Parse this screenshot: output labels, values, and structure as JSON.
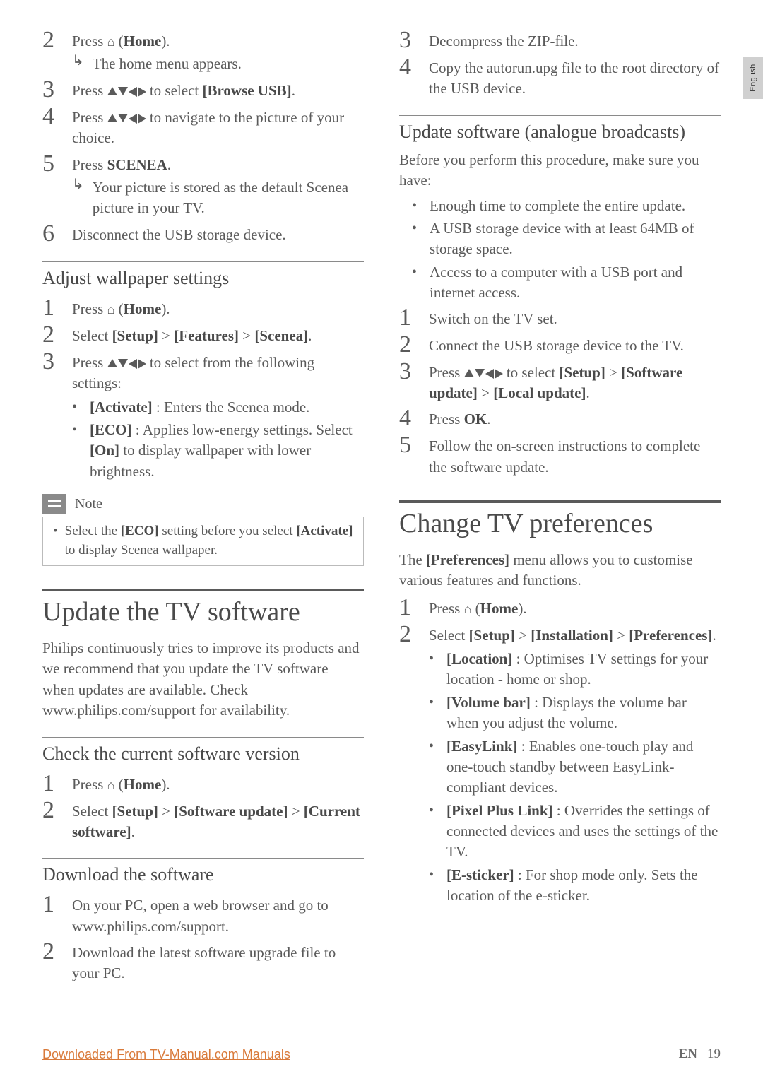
{
  "sideTab": "English",
  "left": {
    "steps1": [
      {
        "n": "2",
        "text": "Press ⌂ (Home).",
        "sub": "The home menu appears."
      },
      {
        "n": "3",
        "text": "Press ▲▼◀▶ to select [Browse USB]."
      },
      {
        "n": "4",
        "text": "Press ▲▼◀▶ to navigate to the picture of your choice."
      },
      {
        "n": "5",
        "text": "Press SCENEA.",
        "sub": "Your picture is stored as the default Scenea picture in your TV."
      },
      {
        "n": "6",
        "text": "Disconnect the USB storage device."
      }
    ],
    "h2_wallpaper": "Adjust wallpaper settings",
    "steps2": [
      {
        "n": "1",
        "text": "Press ⌂ (Home)."
      },
      {
        "n": "2",
        "text": "Select [Setup] > [Features] > [Scenea]."
      },
      {
        "n": "3",
        "text": "Press ▲▼◀▶ to select from the following settings:"
      }
    ],
    "settings_bullets": [
      {
        "bold": "[Activate]",
        "rest": " : Enters the Scenea mode."
      },
      {
        "bold": "[ECO]",
        "rest": " : Applies low-energy settings. Select [On] to display wallpaper with lower brightness."
      }
    ],
    "note_label": "Note",
    "note_text_pre": "Select the ",
    "note_bold1": "[ECO]",
    "note_mid": " setting before you select ",
    "note_bold2": "[Activate]",
    "note_post": " to display Scenea wallpaper.",
    "h1_update": "Update the TV software",
    "update_para": "Philips continuously tries to improve its products and we recommend that you update the TV software when updates are available. Check www.philips.com/support for availability.",
    "h2_check": "Check the current software version",
    "steps3": [
      {
        "n": "1",
        "text": "Press ⌂ (Home)."
      },
      {
        "n": "2",
        "text": "Select [Setup] > [Software update] > [Current software]."
      }
    ],
    "h2_download": "Download the software",
    "steps4": [
      {
        "n": "1",
        "text": "On your PC, open a web browser and go to www.philips.com/support."
      },
      {
        "n": "2",
        "text": "Download the latest software upgrade file to your PC."
      }
    ]
  },
  "right": {
    "steps5": [
      {
        "n": "3",
        "text": "Decompress the ZIP-file."
      },
      {
        "n": "4",
        "text": "Copy the autorun.upg file to the root directory of the USB device."
      }
    ],
    "h2_analogue": "Update software (analogue broadcasts)",
    "analogue_intro": "Before you perform this procedure, make sure you have:",
    "analogue_bullets": [
      "Enough time to complete the entire update.",
      "A USB storage device with at least 64MB of storage space.",
      "Access to a computer with a USB port and internet access."
    ],
    "steps6": [
      {
        "n": "1",
        "text": "Switch on the TV set."
      },
      {
        "n": "2",
        "text": "Connect the USB storage device to the TV."
      },
      {
        "n": "3",
        "text": "Press ▲▼◀▶ to select [Setup] > [Software update] > [Local update]."
      },
      {
        "n": "4",
        "text": "Press OK."
      },
      {
        "n": "5",
        "text": "Follow the on-screen instructions to complete the software update."
      }
    ],
    "h1_prefs": "Change TV preferences",
    "prefs_para_pre": "The ",
    "prefs_para_bold": "[Preferences]",
    "prefs_para_post": " menu allows you to customise various features and functions.",
    "steps7": [
      {
        "n": "1",
        "text": "Press ⌂ (Home)."
      },
      {
        "n": "2",
        "text": "Select [Setup] > [Installation] > [Preferences]."
      }
    ],
    "prefs_bullets": [
      {
        "bold": "[Location]",
        "rest": " : Optimises TV settings for your location - home or shop."
      },
      {
        "bold": "[Volume bar]",
        "rest": " : Displays the volume bar when you adjust the volume."
      },
      {
        "bold": "[EasyLink]",
        "rest": " : Enables one-touch play and one-touch standby between EasyLink-compliant devices."
      },
      {
        "bold": "[Pixel Plus Link]",
        "rest": " : Overrides the settings of connected devices and uses the settings of the TV."
      },
      {
        "bold": "[E-sticker]",
        "rest": " : For shop mode only. Sets the location of the e-sticker."
      }
    ]
  },
  "footer": {
    "link": "Downloaded From TV-Manual.com Manuals",
    "lang": "EN",
    "page": "19"
  }
}
